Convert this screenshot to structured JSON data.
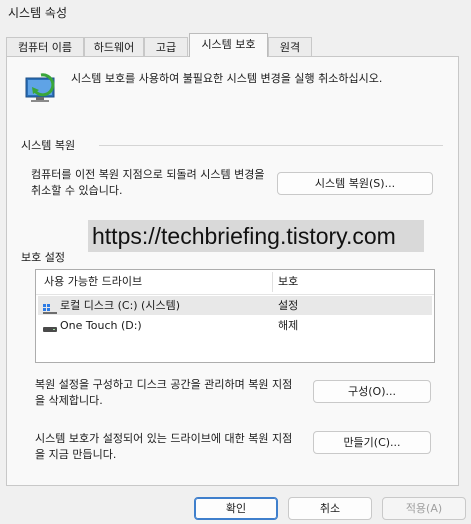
{
  "window": {
    "title": "시스템 속성"
  },
  "tabs": [
    {
      "label": "컴퓨터 이름"
    },
    {
      "label": "하드웨어"
    },
    {
      "label": "고급"
    },
    {
      "label": "시스템 보호"
    },
    {
      "label": "원격"
    }
  ],
  "active_tab": "시스템 보호",
  "intro": {
    "text": "시스템 보호를 사용하여 불필요한 시스템 변경을 실행 취소하십시오."
  },
  "restore": {
    "title": "시스템 복원",
    "description": "컴퓨터를 이전 복원 지점으로 되돌려 시스템 변경을 취소할 수 있습니다.",
    "button": "시스템 복원(S)..."
  },
  "watermark": "https://techbriefing.tistory.com",
  "protection": {
    "title": "보호 설정",
    "columns": [
      "사용 가능한 드라이브",
      "보호"
    ],
    "drives": [
      {
        "name": "로컬 디스크 (C:) (시스템)",
        "status": "설정",
        "icon": "windows-drive-icon",
        "selected": true
      },
      {
        "name": "One Touch (D:)",
        "status": "해제",
        "icon": "external-drive-icon",
        "selected": false
      }
    ],
    "configure_text": "복원 설정을 구성하고 디스크 공간을 관리하며 복원 지점을 삭제합니다.",
    "configure_button": "구성(O)...",
    "create_text": "시스템 보호가 설정되어 있는 드라이브에 대한 복원 지점을 지금 만듭니다.",
    "create_button": "만들기(C)..."
  },
  "footer": {
    "ok": "확인",
    "cancel": "취소",
    "apply": "적용(A)"
  },
  "colors": {
    "accent": "#3f7fcc",
    "panel": "#f9f9f9",
    "window": "#f0f0f0"
  }
}
